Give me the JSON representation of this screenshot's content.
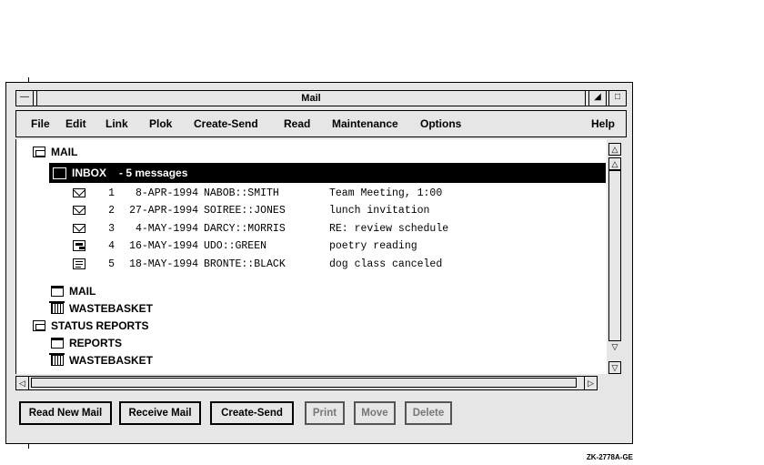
{
  "window": {
    "title": "Mail"
  },
  "menu": [
    "File",
    "Edit",
    "Link",
    "Plok",
    "Create-Send",
    "Read",
    "Maintenance",
    "Options",
    "Help"
  ],
  "tree": {
    "root": "MAIL",
    "inbox_label": "INBOX",
    "inbox_count": "- 5 messages",
    "messages": [
      {
        "num": "1",
        "date": "8-APR-1994",
        "from": "NABOB::SMITH",
        "subject": "Team Meeting, 1:00",
        "icon": "envelope-icon"
      },
      {
        "num": "2",
        "date": "27-APR-1994",
        "from": "SOIREE::JONES",
        "subject": "lunch invitation",
        "icon": "envelope-icon"
      },
      {
        "num": "3",
        "date": "4-MAY-1994",
        "from": "DARCY::MORRIS",
        "subject": "RE: review schedule",
        "icon": "envelope-icon"
      },
      {
        "num": "4",
        "date": "16-MAY-1994",
        "from": "UDO::GREEN",
        "subject": "poetry reading",
        "icon": "read-document-icon"
      },
      {
        "num": "5",
        "date": "18-MAY-1994",
        "from": "BRONTE::BLACK",
        "subject": "dog class canceled",
        "icon": "document-icon"
      }
    ],
    "sub_mail": "MAIL",
    "sub_waste": "WASTEBASKET",
    "status_reports": "STATUS REPORTS",
    "reports": "REPORTS",
    "reports_waste": "WASTEBASKET"
  },
  "buttons": [
    {
      "label": "Read New Mail",
      "enabled": true
    },
    {
      "label": "Receive Mail",
      "enabled": true
    },
    {
      "label": "Create-Send",
      "enabled": true
    },
    {
      "label": "Print",
      "enabled": false
    },
    {
      "label": "Move",
      "enabled": false
    },
    {
      "label": "Delete",
      "enabled": false
    }
  ],
  "figure_code": "ZK-2778A-GE"
}
